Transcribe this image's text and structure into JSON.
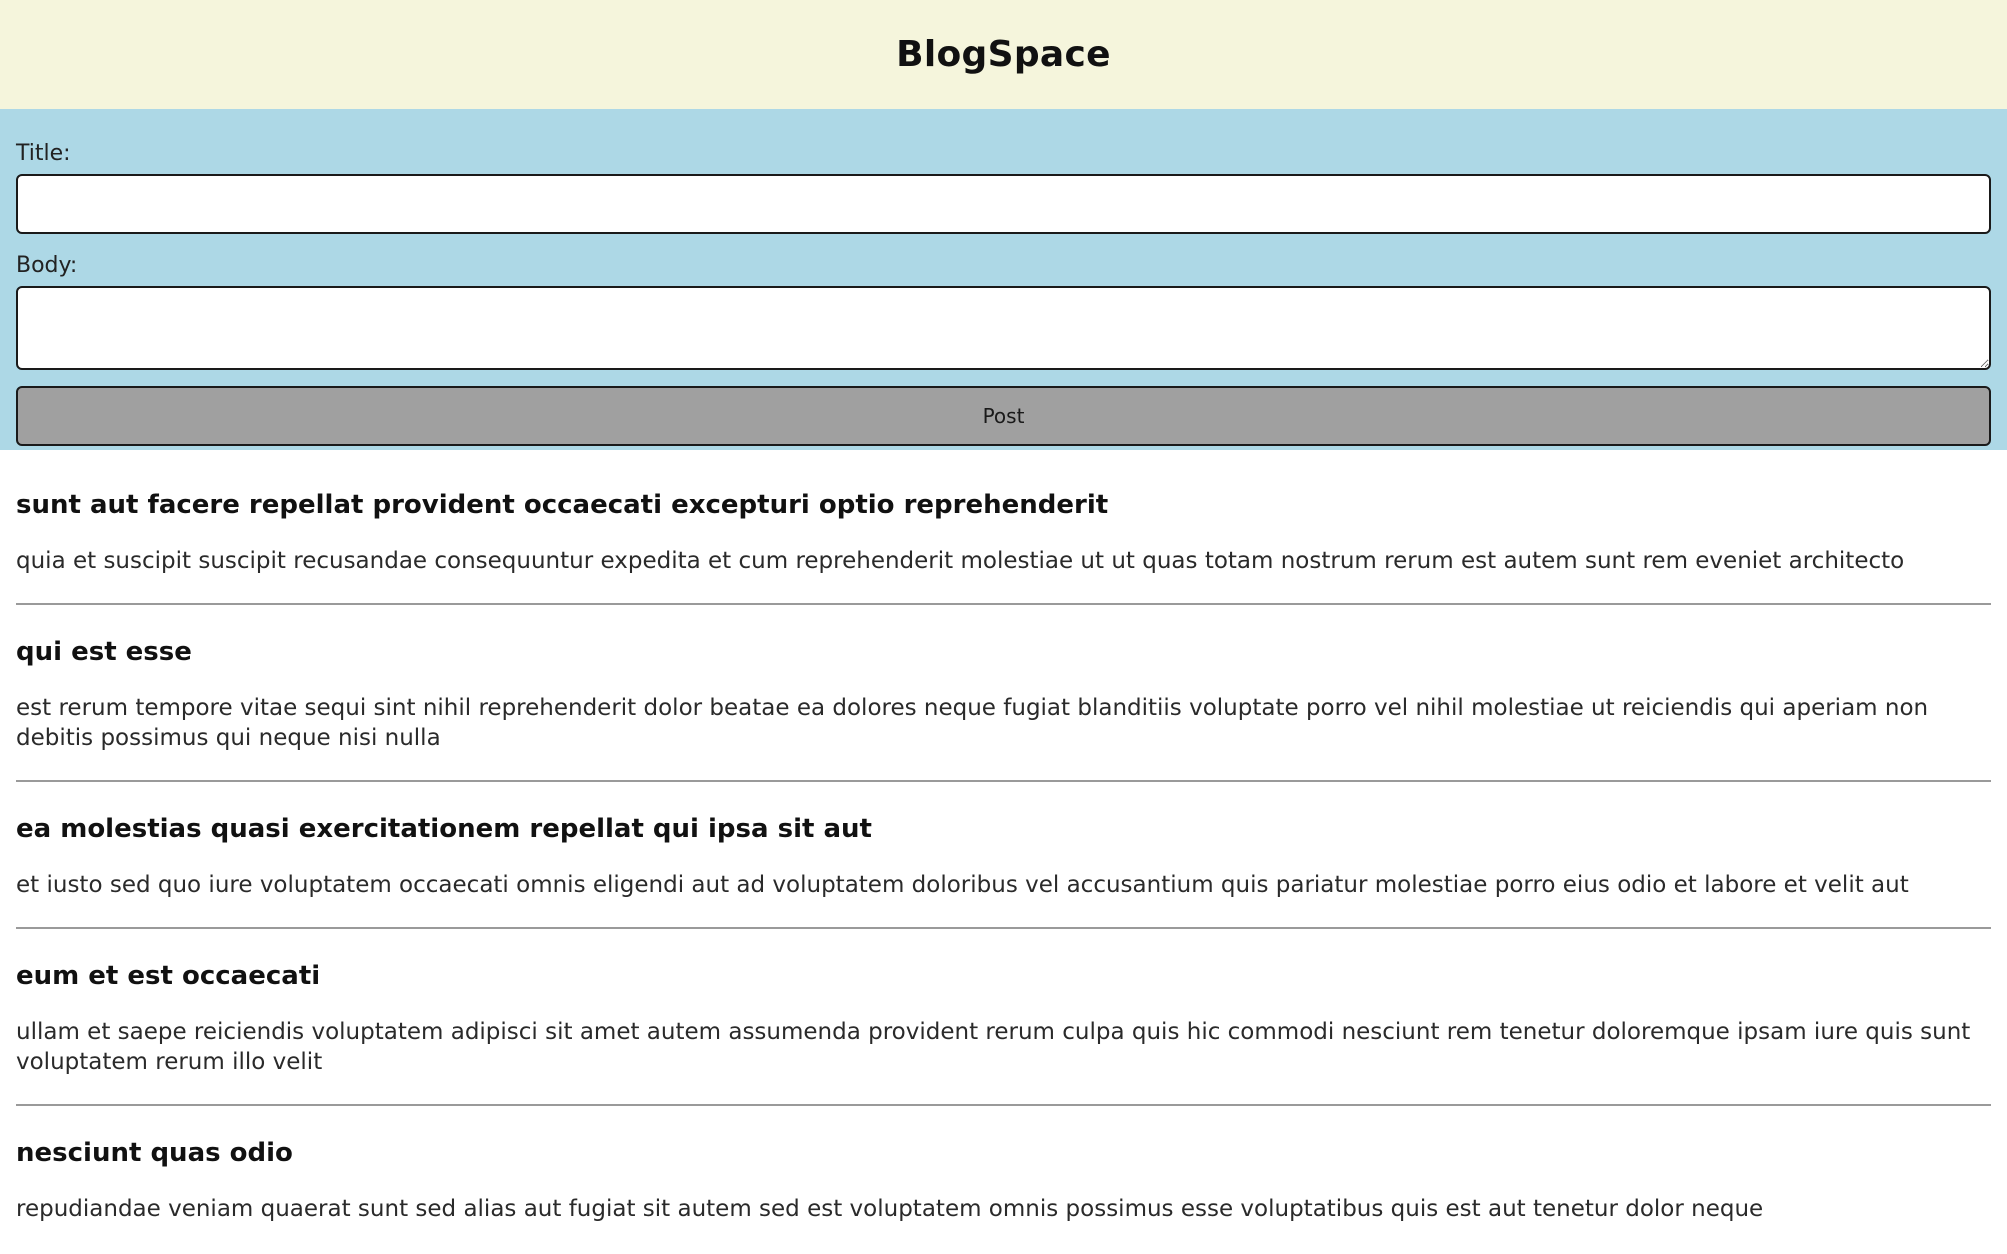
{
  "header": {
    "title": "BlogSpace"
  },
  "form": {
    "title_label": "Title:",
    "title_value": "",
    "body_label": "Body:",
    "body_value": "",
    "submit_label": "Post"
  },
  "posts": [
    {
      "title": "sunt aut facere repellat provident occaecati excepturi optio reprehenderit",
      "body": "quia et suscipit suscipit recusandae consequuntur expedita et cum reprehenderit molestiae ut ut quas totam nostrum rerum est autem sunt rem eveniet architecto"
    },
    {
      "title": "qui est esse",
      "body": "est rerum tempore vitae sequi sint nihil reprehenderit dolor beatae ea dolores neque fugiat blanditiis voluptate porro vel nihil molestiae ut reiciendis qui aperiam non debitis possimus qui neque nisi nulla"
    },
    {
      "title": "ea molestias quasi exercitationem repellat qui ipsa sit aut",
      "body": "et iusto sed quo iure voluptatem occaecati omnis eligendi aut ad voluptatem doloribus vel accusantium quis pariatur molestiae porro eius odio et labore et velit aut"
    },
    {
      "title": "eum et est occaecati",
      "body": "ullam et saepe reiciendis voluptatem adipisci sit amet autem assumenda provident rerum culpa quis hic commodi nesciunt rem tenetur doloremque ipsam iure quis sunt voluptatem rerum illo velit"
    },
    {
      "title": "nesciunt quas odio",
      "body": "repudiandae veniam quaerat sunt sed alias aut fugiat sit autem sed est voluptatem omnis possimus esse voluptatibus quis est aut tenetur dolor neque"
    }
  ],
  "colors": {
    "header_bg": "#f5f5dc",
    "form_bg": "#add8e6",
    "button_bg": "#a0a0a0",
    "divider": "#9a9a9a"
  }
}
